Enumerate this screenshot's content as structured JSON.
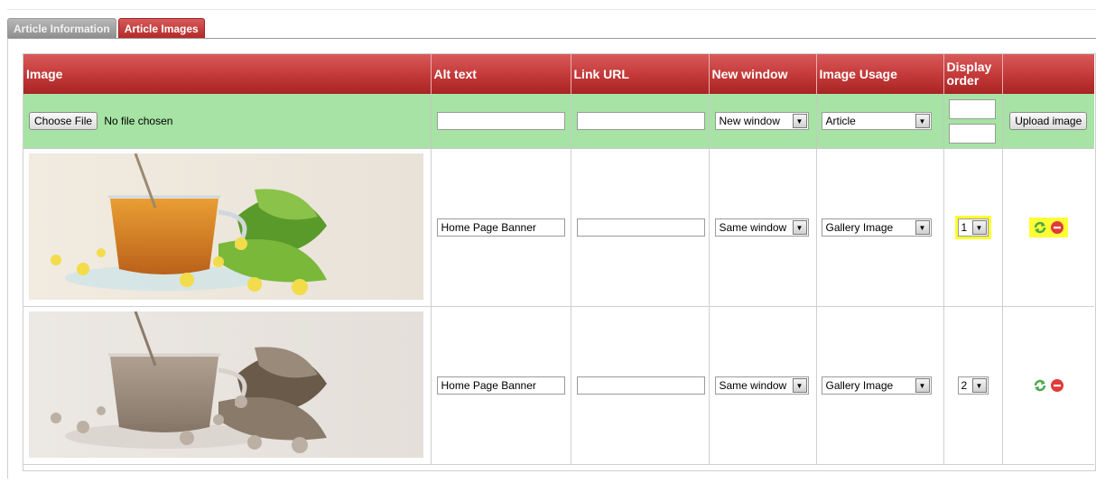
{
  "tabs": [
    {
      "label": "Article Information",
      "active": false
    },
    {
      "label": "Article Images",
      "active": true
    }
  ],
  "table": {
    "headers": {
      "image": "Image",
      "alt_text": "Alt text",
      "link_url": "Link URL",
      "new_window": "New window",
      "image_usage": "Image Usage",
      "display_order_line1": "Display",
      "display_order_line2": "order"
    },
    "upload": {
      "choose_file_label": "Choose File",
      "file_status": "No file chosen",
      "alt_text": "",
      "link_url": "",
      "window_value": "New window",
      "usage_value": "Article",
      "order_value_1": "",
      "order_value_2": "",
      "upload_button": "Upload image"
    },
    "rows": [
      {
        "alt_text": "Home Page Banner",
        "link_url": "",
        "window_value": "Same window",
        "usage_value": "Gallery Image",
        "order_value": "1",
        "highlighted": true,
        "image_style": "color"
      },
      {
        "alt_text": "Home Page Banner",
        "link_url": "",
        "window_value": "Same window",
        "usage_value": "Gallery Image",
        "order_value": "2",
        "highlighted": false,
        "image_style": "sepia"
      }
    ]
  },
  "icons": {
    "refresh": "refresh-icon",
    "delete": "delete-icon",
    "dropdown": "chevron-down-icon"
  },
  "colors": {
    "header_red": "#c33838",
    "upload_row_green": "#a6e3a4",
    "highlight_yellow": "#ffff33",
    "refresh_green": "#4ca84c",
    "delete_red": "#e23a3a"
  }
}
